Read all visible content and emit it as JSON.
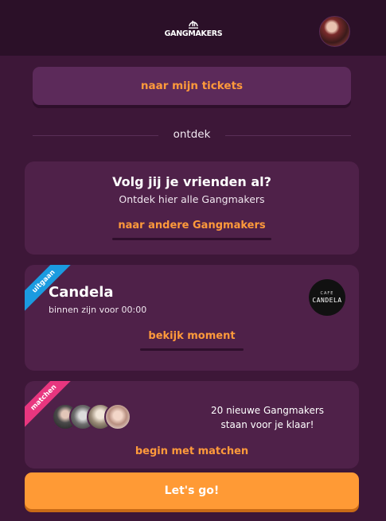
{
  "header": {
    "logo_text": "GANGMAKERS"
  },
  "tickets_button": {
    "label": "naar mijn tickets"
  },
  "divider": {
    "label": "ontdek"
  },
  "friends_card": {
    "title": "Volg jij je vrienden al?",
    "subtitle": "Ontdek hier alle Gangmakers",
    "link_label": "naar andere Gangmakers"
  },
  "moment_card": {
    "ribbon": "uitgaan",
    "name": "Candela",
    "subtitle": "binnen zijn voor 00:00",
    "venue_logo_small": "CAFE",
    "venue_logo_main": "CANDELA",
    "link_label": "bekijk moment"
  },
  "match_card": {
    "ribbon": "matchen",
    "text_line1": "20 nieuwe Gangmakers",
    "text_line2": "staan voor je klaar!",
    "link_label": "begin met matchen"
  },
  "primary_button": {
    "label": "Let's go!"
  },
  "colors": {
    "background": "#3d1738",
    "topbar": "#2b1028",
    "card": "#4f2149",
    "accent_orange": "#ff9a3b",
    "ribbon_blue": "#1b9be0",
    "ribbon_pink": "#e8367f"
  }
}
